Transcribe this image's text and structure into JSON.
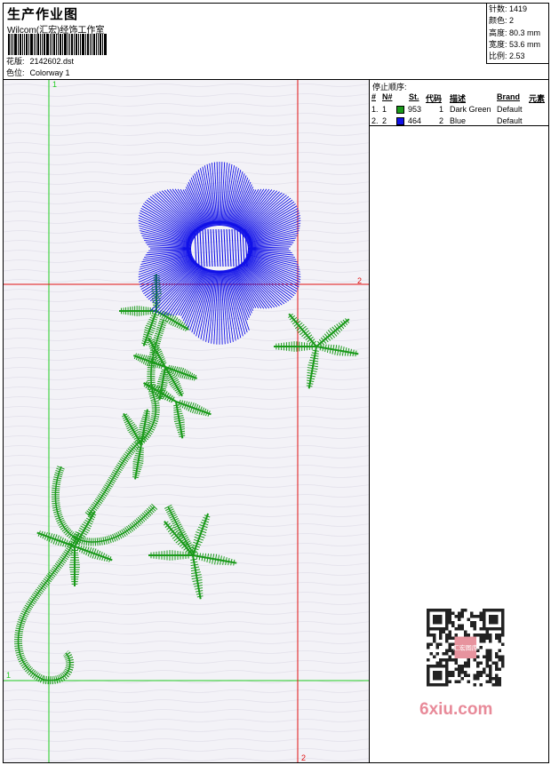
{
  "header": {
    "title": "生产作业图",
    "company": "Wilcom(汇宏)经饰工作室",
    "design_label": "花版:",
    "design_value": "2142602.dst",
    "colorway_label": "色位:",
    "colorway_value": "Colorway 1"
  },
  "stats": [
    {
      "label": "针数:",
      "value": "1419"
    },
    {
      "label": "颜色:",
      "value": "2"
    },
    {
      "label": "高度:",
      "value": "80.3 mm"
    },
    {
      "label": "宽度:",
      "value": "53.6 mm"
    },
    {
      "label": "比例:",
      "value": "2.53"
    }
  ],
  "stop_sequence": {
    "caption": "停止顺序:",
    "headers": {
      "seq": "#",
      "no": "N#",
      "st": "St.",
      "code": "代码",
      "desc": "描述",
      "brand": "Brand",
      "element": "元素"
    },
    "rows": [
      {
        "seq": "1.",
        "no": "1",
        "color": "#1a9a1a",
        "st": "953",
        "code": "1",
        "desc": "Dark Green",
        "brand": "Default"
      },
      {
        "seq": "2.",
        "no": "2",
        "color": "#1010e8",
        "st": "464",
        "code": "2",
        "desc": "Blue",
        "brand": "Default"
      }
    ]
  },
  "guides": {
    "v1_label": "1",
    "h1_label": "1",
    "h2_label": "2",
    "v2_label": "2",
    "green": "#22cc22",
    "red": "#e01010"
  },
  "watermark": {
    "text": "6xiu.com",
    "stamp_text": "汇宏图库"
  }
}
